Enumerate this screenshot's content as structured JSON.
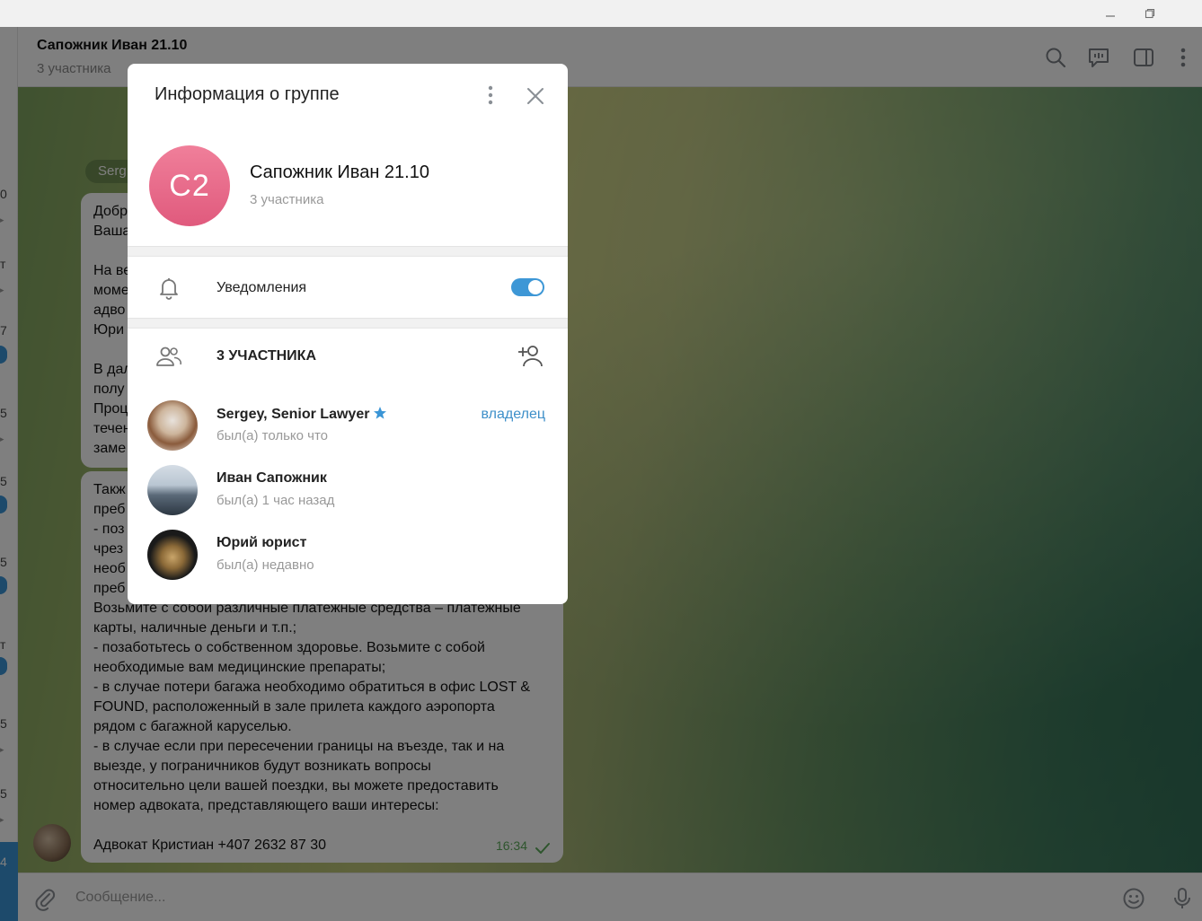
{
  "window": {
    "minimize_icon": "minimize-icon",
    "restore_icon": "restore-icon"
  },
  "chat": {
    "title": "Сапожник Иван 21.10",
    "subtitle": "3 участника",
    "sender_chip": "Serg",
    "bubble1_text": "Добр\nВаша\n\nНа ве\nмоме\nадво\nЮри\n\nВ дал\nполу\nПроц\nтечен\nзаме",
    "bubble2_text": "Такж\nпреб\n- поз\nчрез\nнеоб\nпреб\nВозьмите с собой различные платежные средства – платежные\nкарты, наличные деньги и т.п.;\n- позаботьтесь о собственном здоровье. Возьмите с собой\nнеобходимые вам медицинские препараты;\n- в случае потери багажа необходимо обратиться в офис LOST &\nFOUND, расположенный в зале прилета каждого аэропорта\nрядом с багажной каруселью.\n- в случае если при пересечении границы на въезде, так и на\nвыезде, у пограничников будут возникать вопросы\nотносительно цели вашей поездки, вы можете предоставить\nномер адвоката, представляющего ваши интересы:\n\nАдвокат Кристиан +407 2632 87 30",
    "message_time": "16:34",
    "composer_placeholder": "Сообщение..."
  },
  "left_strip": {
    "fragments": [
      "0",
      "т",
      "7",
      "5",
      "5",
      "5",
      "т",
      "5",
      "5"
    ],
    "selected_fragment": "4"
  },
  "modal": {
    "title": "Информация о группе",
    "group_name": "Сапожник Иван 21.10",
    "avatar_initials": "С2",
    "member_count": "3 участника",
    "notifications_label": "Уведомления",
    "notifications_enabled": true,
    "members_header": "3 УЧАСТНИКА",
    "members": [
      {
        "name": "Sergey, Senior Lawyer",
        "status": "был(а) только что",
        "role": "владелец",
        "verified": true
      },
      {
        "name": "Иван Сапожник",
        "status": "был(а) 1 час назад",
        "role": ""
      },
      {
        "name": "Юрий юрист",
        "status": "был(а) недавно",
        "role": ""
      }
    ]
  },
  "colors": {
    "accent": "#3d97d6",
    "avatar_pink": "#e8698a",
    "check_green": "#5daa5b"
  }
}
